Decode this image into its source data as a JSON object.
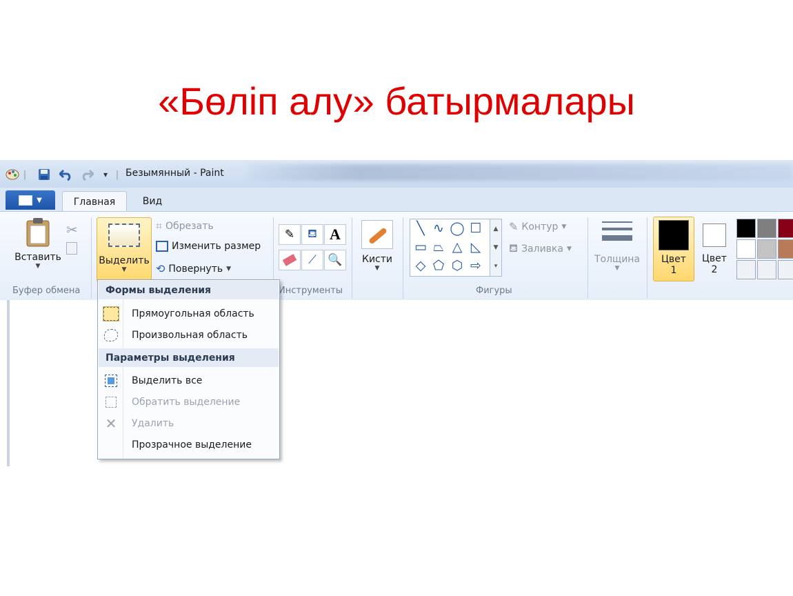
{
  "slide": {
    "title": "«Бөліп алу» батырмалары"
  },
  "window": {
    "title": "Безымянный - Paint"
  },
  "tabs": [
    {
      "label": "Главная"
    },
    {
      "label": "Вид"
    }
  ],
  "clipboard": {
    "paste_label": "Вставить",
    "group_label": "Буфер обмена"
  },
  "image": {
    "select_label": "Выделить",
    "crop_label": "Обрезать",
    "resize_label": "Изменить размер",
    "rotate_label": "Повернуть"
  },
  "tools": {
    "group_label": "Инструменты",
    "text_glyph": "A"
  },
  "brushes": {
    "label": "Кисти"
  },
  "shapes": {
    "group_label": "Фигуры",
    "outline_label": "Контур",
    "fill_label": "Заливка"
  },
  "size": {
    "label": "Толщина"
  },
  "colors": {
    "color1_line1": "Цвет",
    "color1_line2": "1",
    "color2_line1": "Цвет",
    "color2_line2": "2",
    "color1_value": "#000000",
    "color2_value": "#ffffff",
    "palette": [
      "#000000",
      "#7f7f7f",
      "#880015",
      "#ffffff",
      "#c3c3c3",
      "#b97a57"
    ]
  },
  "select_menu": {
    "header_shapes": "Формы выделения",
    "rect": "Прямоугольная область",
    "free": "Произвольная область",
    "header_options": "Параметры выделения",
    "select_all": "Выделить все",
    "invert": "Обратить выделение",
    "delete": "Удалить",
    "transparent": "Прозрачное выделение"
  }
}
